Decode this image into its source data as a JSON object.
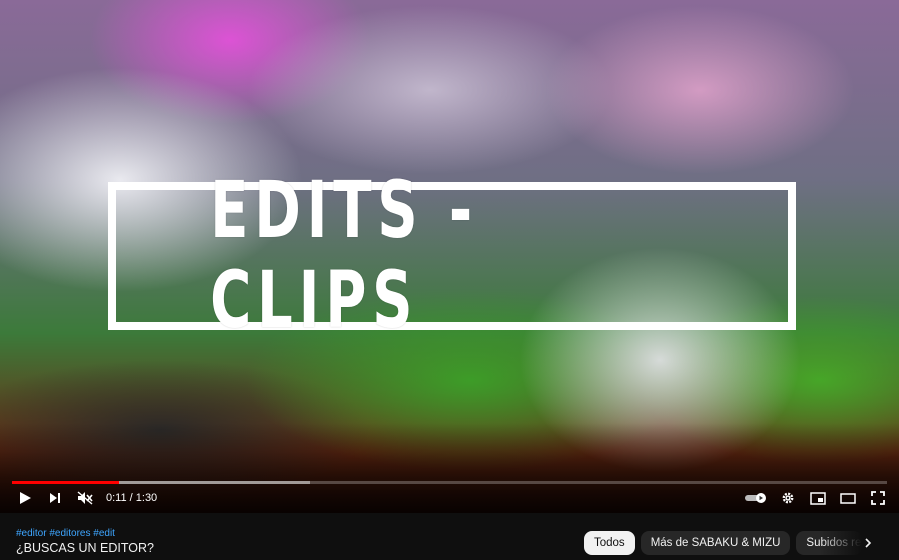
{
  "player": {
    "overlay_text": "EDITS - CLIPS",
    "progress": {
      "played_fraction": 0.122,
      "buffered_fraction": 0.34
    },
    "time": {
      "current": "0:11",
      "separator": " / ",
      "duration": "1:30"
    },
    "icons": {
      "play": "play-icon",
      "next": "next-icon",
      "mute": "volume-muted-icon",
      "autoplay": "autoplay-toggle-icon",
      "settings": "gear-icon",
      "miniplayer": "miniplayer-icon",
      "theater": "theater-icon",
      "fullscreen": "fullscreen-icon"
    }
  },
  "video": {
    "hashtags": "#editor #editores #edit",
    "title": "¿BUSCAS UN EDITOR?"
  },
  "chips": [
    {
      "label": "Todos",
      "active": true
    },
    {
      "label": "Más de SABAKU & MIZU",
      "active": false
    },
    {
      "label": "Subidos re",
      "active": false
    }
  ],
  "colors": {
    "accent": "#ff0000",
    "hashtag": "#3ea6ff",
    "background": "#0f0f0f"
  }
}
